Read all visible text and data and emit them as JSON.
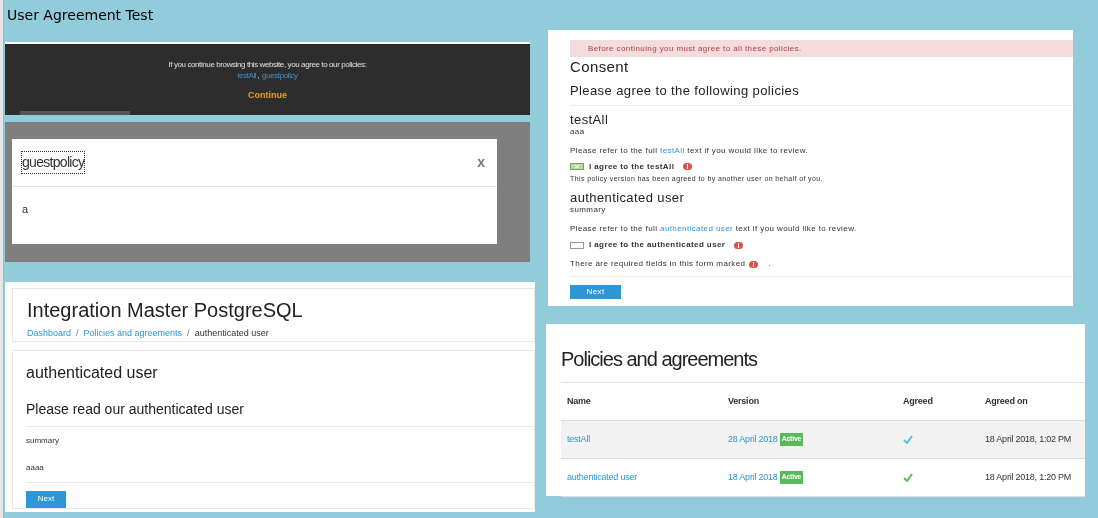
{
  "page_title": "User Agreement Test",
  "cookie_banner": {
    "message": "If you continue browsing this website, you agree to our policies:",
    "links": [
      "testAll",
      "guestpolicy"
    ],
    "separator": ",",
    "continue_label": "Continue"
  },
  "policy_modal": {
    "title": "guestpolicy",
    "close_label": "x",
    "body": "a"
  },
  "policy_view": {
    "site_title": "Integration Master PostgreSQL",
    "separator": "/",
    "breadcrumb": [
      {
        "label": "Dashboard",
        "link": true
      },
      {
        "label": "Policies and agreements",
        "link": true
      },
      {
        "label": "authenticated user",
        "link": false
      }
    ],
    "heading": "authenticated user",
    "subheading": "Please read our authenticated user",
    "summary": "summary",
    "content": "aaaa",
    "next_label": "Next"
  },
  "consent": {
    "alert": "Before continuing you must agree to all these policies.",
    "title": "Consent",
    "subtitle": "Please agree to the following policies",
    "policies": [
      {
        "name": "testAll",
        "summary": "aaa",
        "refer_before": "Please refer to the full",
        "link": "testAll",
        "refer_after": "text if you would like to review.",
        "agree_label": "I agree to the testAll",
        "checked": true,
        "disabled": true,
        "note": "This policy version has been agreed to by another user on behalf of you."
      },
      {
        "name": "authenticated user",
        "summary": "summary",
        "refer_before": "Please refer to the full",
        "link": "authenticated user",
        "refer_after": "text if you would like to review.",
        "agree_label": "I agree to the authenticated user",
        "checked": false,
        "disabled": false
      }
    ],
    "required_before": "There are required fields in this form marked",
    "required_after": ".",
    "next_label": "Next"
  },
  "policies_table": {
    "title": "Policies and agreements",
    "columns": [
      "Name",
      "Version",
      "Agreed",
      "Agreed on"
    ],
    "rows": [
      {
        "name": "testAll",
        "version": "28 April 2018",
        "badge": "Active",
        "agreed": true,
        "agreed_on": "18 April 2018, 1:02 PM",
        "highlighted": true
      },
      {
        "name": "authenticated user",
        "version": "18 April 2018",
        "badge": "Active",
        "agreed": true,
        "agreed_on": "18 April 2018, 1:20 PM",
        "highlighted": false
      }
    ]
  }
}
